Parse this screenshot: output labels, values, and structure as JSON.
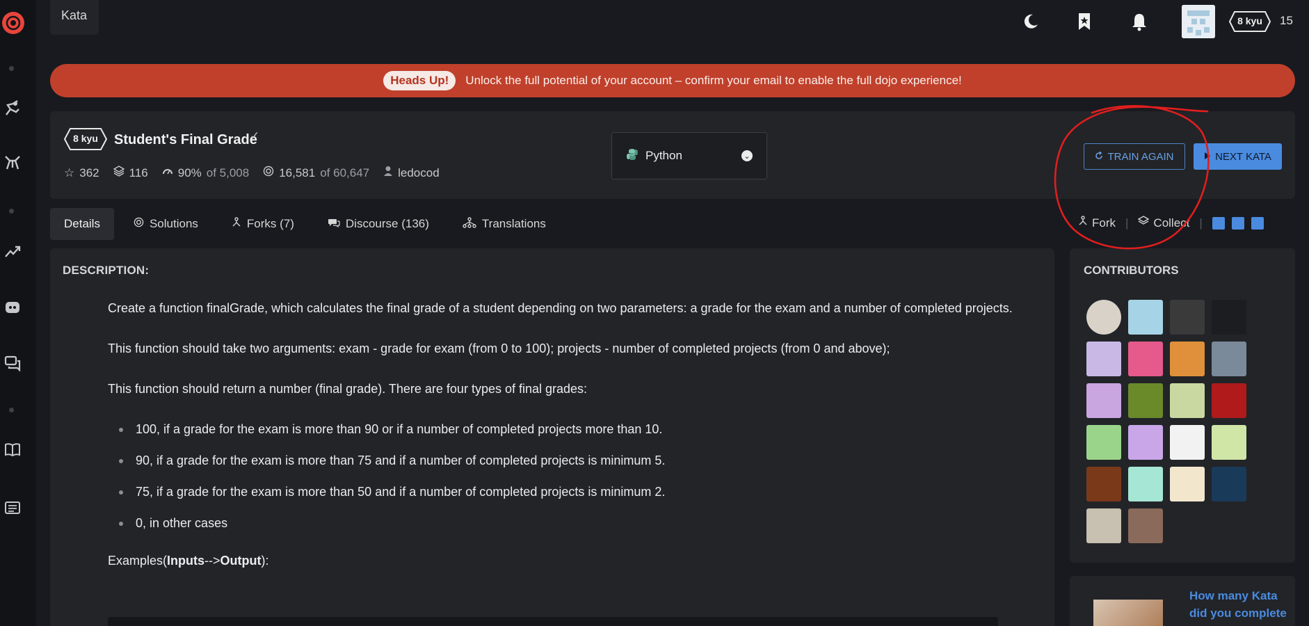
{
  "topbar": {
    "tab_label": "Kata",
    "honor": "15",
    "rank_badge": "8 kyu"
  },
  "banner": {
    "pill": "Heads Up!",
    "message": "Unlock the full potential of your account – confirm your email to enable the full dojo experience!"
  },
  "kata": {
    "rank": "8 kyu",
    "title": "Student's Final Grade",
    "stats": {
      "stars": "362",
      "collections": "116",
      "satisfaction": "90%",
      "satisfaction_of": "of 5,008",
      "completed": "16,581",
      "completed_of": "of 60,647",
      "author": "ledocod"
    },
    "language": "Python",
    "train_again": "TRAIN AGAIN",
    "next_kata": "NEXT KATA"
  },
  "tabs": [
    {
      "label": "Details"
    },
    {
      "label": "Solutions"
    },
    {
      "label": "Forks (7)"
    },
    {
      "label": "Discourse (136)"
    },
    {
      "label": "Translations"
    }
  ],
  "actions": {
    "fork": "Fork",
    "sep1": "|",
    "collect": "Collect",
    "sep2": "|"
  },
  "description": {
    "heading": "DESCRIPTION:",
    "p1": "Create a function finalGrade, which calculates the final grade of a student depending on two parameters: a grade for the exam and a number of completed projects.",
    "p2": "This function should take two arguments: exam - grade for exam (from 0 to 100); projects - number of completed projects (from 0 and above);",
    "p3": "This function should return a number (final grade). There are four types of final grades:",
    "bullets": [
      "100, if a grade for the exam is more than 90 or if a number of completed projects more than 10.",
      "90, if a grade for the exam is more than 75 and if a number of completed projects is minimum 5.",
      "75, if a grade for the exam is more than 50 and if a number of completed projects is minimum 2.",
      "0, in other cases"
    ],
    "examples_prefix": "Examples(",
    "examples_inputs": "Inputs",
    "examples_arrow": "-->",
    "examples_output": "Output",
    "examples_suffix": "):"
  },
  "contributors": {
    "heading": "CONTRIBUTORS",
    "avatar_colors": [
      "#d8d2c8",
      "#a6d4e6",
      "#3a3a3a",
      "#1c1d20",
      "#c9b8e6",
      "#e55a8a",
      "#e0903a",
      "#7a8a9a",
      "#c9a6e0",
      "#6a8a2a",
      "#c8d8a0",
      "#b01a1a",
      "#9ad48a",
      "#c9a6e8",
      "#f2f2f2",
      "#cfe6a6",
      "#7a3a1a",
      "#a6e6d4",
      "#f2e6cc",
      "#1a3a5a",
      "#c8c0b0",
      "#8a6a5a"
    ]
  },
  "promo": {
    "link": "How many Kata did you complete"
  }
}
